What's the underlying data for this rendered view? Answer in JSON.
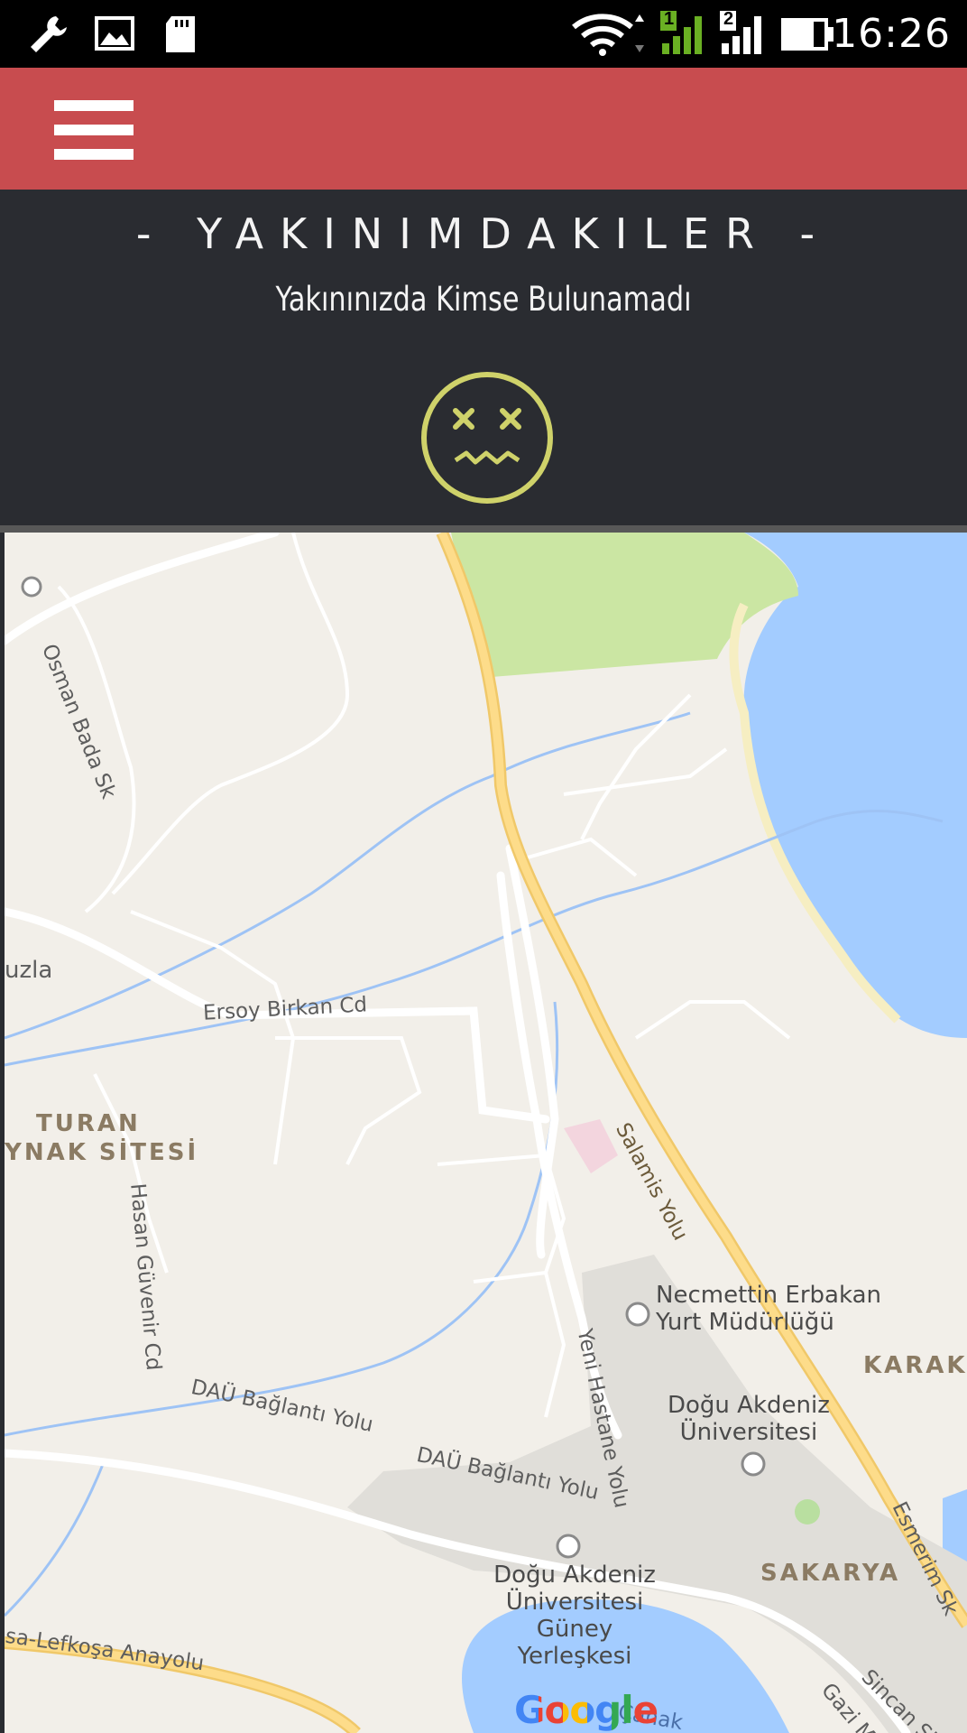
{
  "status_bar": {
    "time": "16:26",
    "sim1": "1",
    "sim2": "2",
    "icons": [
      "wrench-icon",
      "image-icon",
      "sd-card-icon",
      "wifi-icon",
      "signal-1-icon",
      "signal-2-icon",
      "battery-icon"
    ]
  },
  "app_bar": {
    "menu_icon": "hamburger-menu-icon",
    "accent_color": "#c84c4f"
  },
  "nearby": {
    "title": "- YAKINIMDAKILER -",
    "empty_message": "Yakınınızda Kimse Bulunamadı",
    "empty_icon": "dizzy-face-icon",
    "icon_color": "#cfd26a",
    "background_color": "#2a2c31"
  },
  "map": {
    "street_labels": [
      "Osman Bada Sk",
      "Ersoy Birkan Cd",
      "Hasan Güvenir Cd",
      "Salamis Yolu",
      "Yeni Hastane Yolu",
      "DAÜ Bağlantı Yolu",
      "DAÜ Bağlantı Yolu",
      "sa-Lefkoşa Anayolu",
      "Esmerim Sk",
      "Sincan Sk",
      "Gazi Mu",
      "Çanak"
    ],
    "area_labels": [
      "uzla",
      "TURAN",
      "YNAK SİTESİ",
      "KARAKO",
      "SAKARYA"
    ],
    "pois": [
      {
        "name_line1": "Necmettin Erbakan",
        "name_line2": "Yurt Müdürlüğü"
      },
      {
        "name_line1": "Doğu Akdeniz",
        "name_line2": "Üniversitesi"
      },
      {
        "name_line1": "Doğu Akdeniz",
        "name_line2": "Üniversitesi",
        "name_line3": "Güney",
        "name_line4": "Yerleşkesi"
      }
    ],
    "attribution": "Google"
  }
}
